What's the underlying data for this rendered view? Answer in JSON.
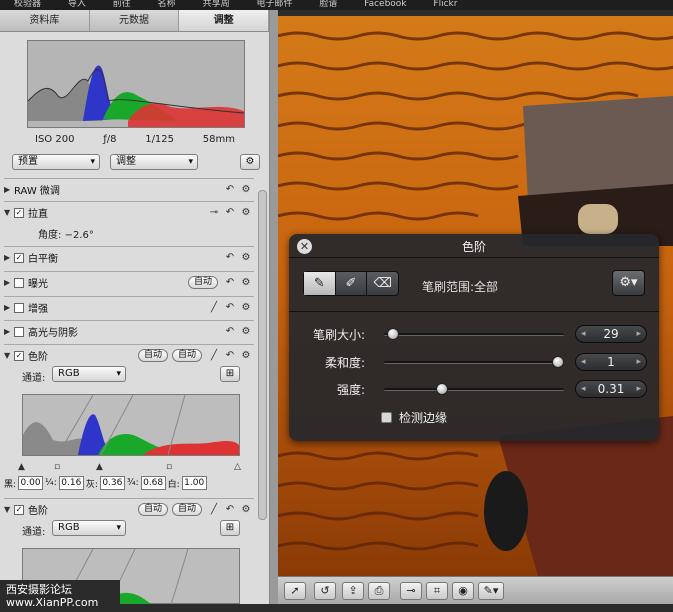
{
  "menubar": [
    "校验器",
    "导入",
    "前往",
    "名称",
    "共享周",
    "电子邮件",
    "脸谱",
    "Facebook",
    "Flickr"
  ],
  "tabs": [
    {
      "label": "资料库"
    },
    {
      "label": "元数据"
    },
    {
      "label": "调整"
    }
  ],
  "exif": {
    "iso": "ISO 200",
    "aperture": "ƒ/8",
    "shutter": "1/125",
    "focal": "58mm"
  },
  "presets": {
    "preset_label": "预置",
    "adjust_label": "调整"
  },
  "adjustments": [
    {
      "label": "RAW 微调",
      "checked": false
    },
    {
      "label": "拉直",
      "checked": true,
      "detail_label": "角度:",
      "detail_value": "−2.6°"
    },
    {
      "label": "白平衡",
      "checked": true
    },
    {
      "label": "曝光",
      "checked": false,
      "auto": "自动"
    },
    {
      "label": "增强",
      "checked": false
    },
    {
      "label": "高光与阴影",
      "checked": false
    }
  ],
  "levels": [
    {
      "label": "色阶",
      "checked": true,
      "auto1": "自动",
      "auto2": "自动",
      "channel_label": "通道:",
      "channel": "RGB",
      "values": [
        {
          "k": "黑:",
          "v": "0.00"
        },
        {
          "k": "¼:",
          "v": "0.16"
        },
        {
          "k": "灰:",
          "v": "0.36"
        },
        {
          "k": "¾:",
          "v": "0.68"
        },
        {
          "k": "白:",
          "v": "1.00"
        }
      ]
    },
    {
      "label": "色阶",
      "checked": true,
      "auto1": "自动",
      "auto2": "自动",
      "channel_label": "通道:",
      "channel": "RGB"
    }
  ],
  "hud": {
    "title": "色阶",
    "brush_range": "笔刷范围:全部",
    "sliders": [
      {
        "label": "笔刷大小:",
        "value": "29",
        "level": 0.02
      },
      {
        "label": "柔和度:",
        "value": "1",
        "level": 1.0
      },
      {
        "label": "强度:",
        "value": "0.31",
        "level": 0.31
      }
    ],
    "detect_edges": "检测边缘"
  },
  "watermark": {
    "line1": "西安摄影论坛",
    "line2": "www.XianPP.com"
  },
  "colors": {
    "hud_bg": "#26282c",
    "photo_orange": "#c96a12"
  }
}
